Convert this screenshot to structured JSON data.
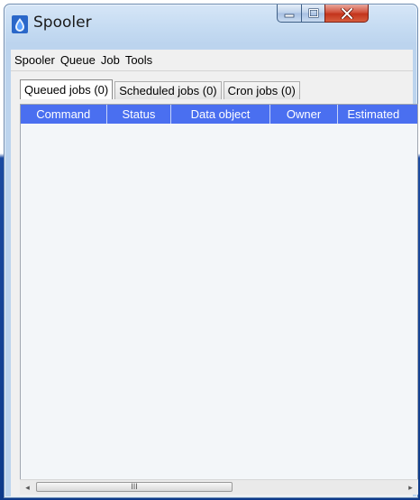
{
  "window": {
    "title": "Spooler",
    "controls": {
      "minimize_icon": "minimize-icon",
      "maximize_icon": "maximize-icon",
      "close_icon": "close-icon"
    }
  },
  "menubar": {
    "items": [
      {
        "label": "Spooler"
      },
      {
        "label": "Queue"
      },
      {
        "label": "Job"
      },
      {
        "label": "Tools"
      }
    ]
  },
  "tabs": [
    {
      "label": "Queued jobs (0)",
      "active": true
    },
    {
      "label": "Scheduled jobs (0)",
      "active": false
    },
    {
      "label": "Cron jobs (0)",
      "active": false
    }
  ],
  "table": {
    "columns": [
      {
        "label": "Command"
      },
      {
        "label": "Status"
      },
      {
        "label": "Data object"
      },
      {
        "label": "Owner"
      },
      {
        "label": "Estimated"
      }
    ],
    "rows": []
  },
  "scrollbar": {
    "left_arrow": "◂",
    "right_arrow": "▸",
    "grip": "III"
  },
  "colors": {
    "header_bg": "#4a6ff0",
    "close_button": "#c3341c"
  }
}
